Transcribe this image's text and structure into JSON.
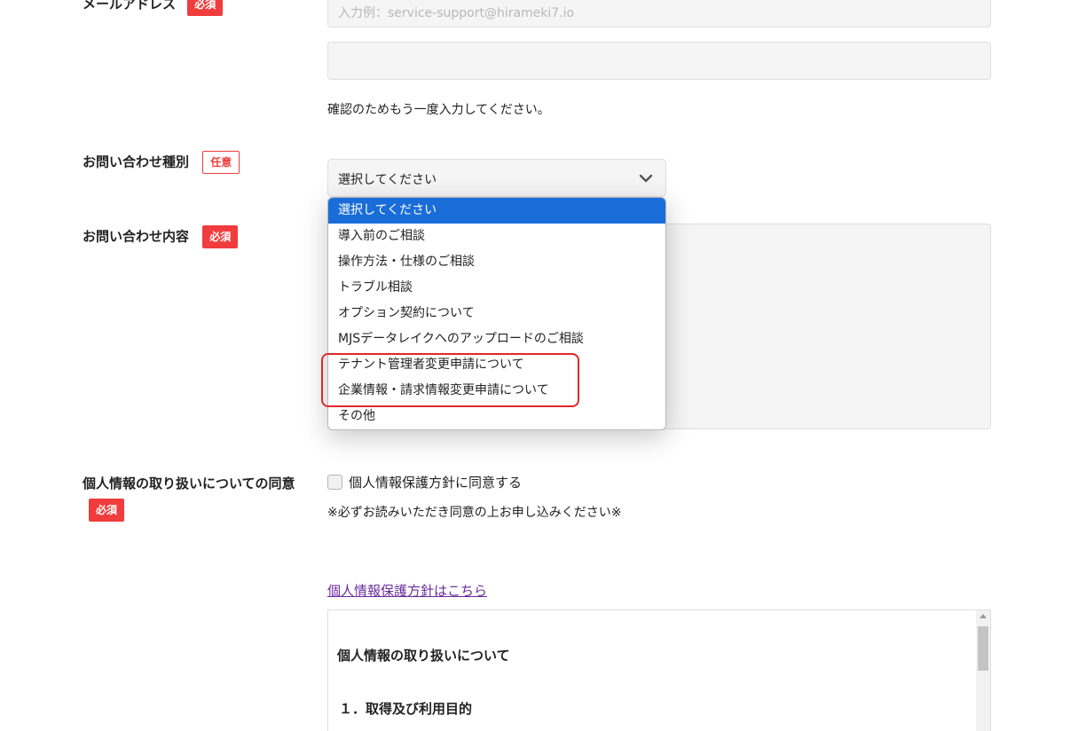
{
  "email": {
    "label": "メールアドレス",
    "badge": "必須",
    "placeholder": "入力例：service-support@hirameki7.io",
    "confirm_value": "",
    "confirm_note": "確認のためもう一度入力してください。"
  },
  "inquiry_type": {
    "label": "お問い合わせ種別",
    "badge": "任意",
    "selected": "選択してください",
    "options": [
      "選択してください",
      "導入前のご相談",
      "操作方法・仕様のご相談",
      "トラブル相談",
      "オプション契約について",
      "MJSデータレイクへのアップロードのご相談",
      "テナント管理者変更申請について",
      "企業情報・請求情報変更申請について",
      "その他"
    ]
  },
  "inquiry_content": {
    "label": "お問い合わせ内容",
    "badge": "必須"
  },
  "consent": {
    "label": "個人情報の取り扱いについての同意",
    "badge": "必須",
    "checkbox_label": "個人情報保護方針に同意する",
    "checked": false,
    "note": "※必ずお読みいただき同意の上お申し込みください※"
  },
  "policy": {
    "link_text": "個人情報保護方針はこちら",
    "heading": "個人情報の取り扱いについて",
    "section1": "１．取得及び利用目的"
  },
  "colors": {
    "required_badge": "#f03c3c",
    "selected_option": "#1a6dd8",
    "highlight_border": "#e3272b",
    "link": "#6a2c9c"
  }
}
